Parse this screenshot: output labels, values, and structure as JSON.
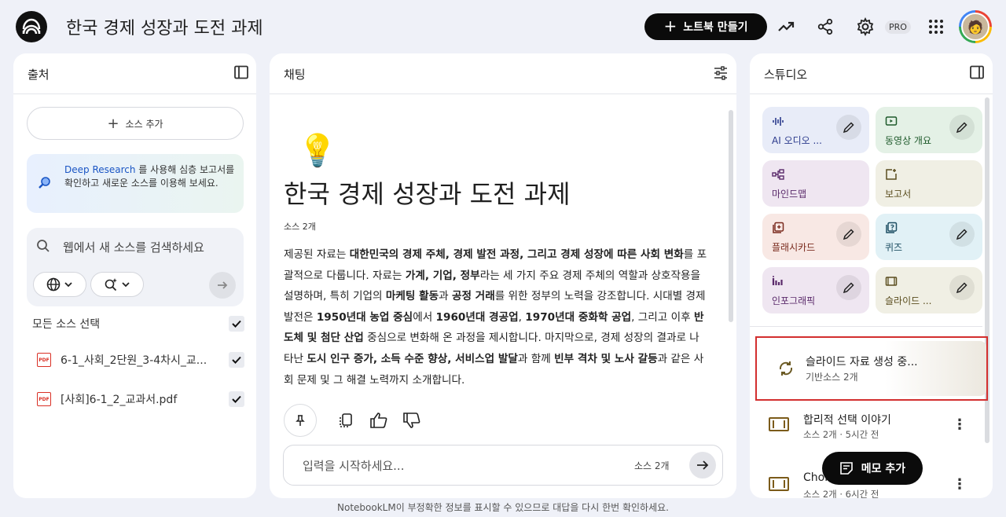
{
  "header": {
    "title": "한국 경제 성장과 도전 과제",
    "create_notebook": "노트북 만들기",
    "plus": "+",
    "pro_badge": "PRO",
    "avatar_glyph": "🧑"
  },
  "sources": {
    "title": "출처",
    "add_source": "소스 추가",
    "plus": "+",
    "deep_research_link": "Deep Research",
    "deep_research_text": " 를 사용해 심층 보고서를 확인하고 새로운 소스를 이용해 보세요.",
    "web_search_placeholder": "웹에서 새 소스를 검색하세요",
    "select_all": "모든 소스 선택",
    "pdf_badge": "PDF",
    "items": [
      {
        "name": "6-1_사회_2단원_3-4차시_교..."
      },
      {
        "name": "[사회]6-1_2_교과서.pdf"
      }
    ]
  },
  "chat": {
    "title": "채팅",
    "bulb": "💡",
    "heading": "한국 경제 성장과 도전 과제",
    "source_count": "소스 2개",
    "input_placeholder": "입력을 시작하세요...",
    "input_source_count": "소스 2개"
  },
  "studio": {
    "title": "스튜디오",
    "tiles": [
      {
        "label": "AI 오디오 ...",
        "bg": "#e8ecf8",
        "fg": "#2b3a8c"
      },
      {
        "label": "동영상 개요",
        "bg": "#e4f1e6",
        "fg": "#1e5a2b"
      },
      {
        "label": "마인드맵",
        "bg": "#efe6f1",
        "fg": "#5b2b6b"
      },
      {
        "label": "보고서",
        "bg": "#f0efe4",
        "fg": "#5a4d1e"
      },
      {
        "label": "플래시카드",
        "bg": "#f8e8e4",
        "fg": "#7a2b1e"
      },
      {
        "label": "퀴즈",
        "bg": "#e1f1f6",
        "fg": "#1e4f63"
      },
      {
        "label": "인포그래픽",
        "bg": "#efe6f1",
        "fg": "#5b2b6b"
      },
      {
        "label": "슬라이드 ...",
        "bg": "#f0efe4",
        "fg": "#5a4d1e"
      }
    ],
    "generating": {
      "title": "슬라이드 자료 생성 중...",
      "subtitle": "기반소스 2개"
    },
    "notes": [
      {
        "title": "합리적 선택 이야기",
        "meta": "소스 2개 · 5시간 전"
      },
      {
        "title": "Chor",
        "meta": "소스 2개 · 6시간 전"
      }
    ],
    "more": "⋮",
    "add_memo": "메모 추가"
  },
  "footer": "NotebookLM이 부정확한 정보를 표시할 수 있으므로 대답을 다시 한번 확인하세요."
}
